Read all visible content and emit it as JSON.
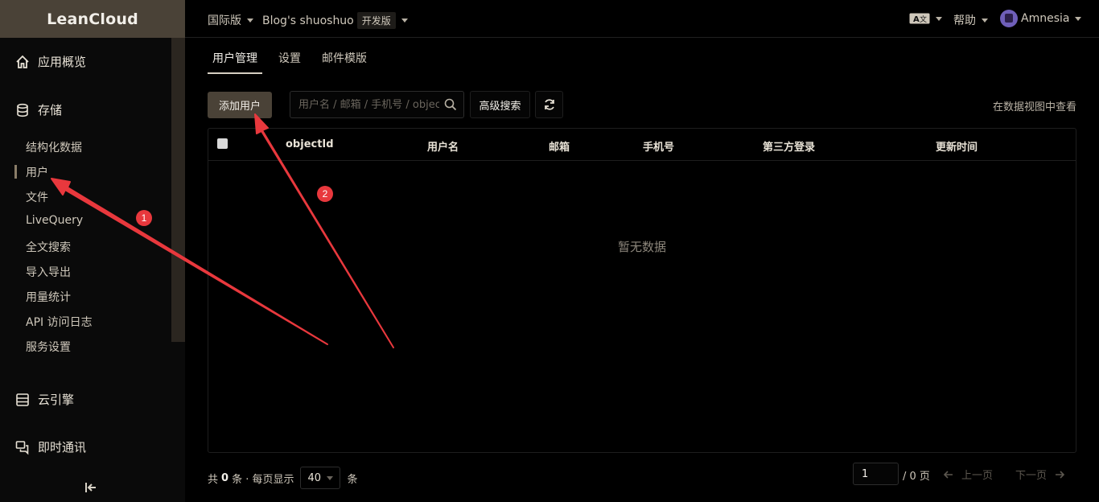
{
  "app": {
    "brand": "LeanCloud"
  },
  "header": {
    "region": "国际版",
    "app_name": "Blog's shuoshuo",
    "edition": "开发版",
    "help": "帮助",
    "username": "Amnesia",
    "lang_icon": "translate-icon"
  },
  "sidebar": {
    "overview": "应用概览",
    "storage": "存储",
    "storage_items": [
      "结构化数据",
      "用户",
      "文件",
      "LiveQuery",
      "全文搜索",
      "导入导出",
      "用量统计",
      "API 访问日志",
      "服务设置"
    ],
    "active_item": "用户",
    "cloud_engine": "云引擎",
    "messaging": "即时通讯"
  },
  "tabs": [
    "用户管理",
    "设置",
    "邮件模版"
  ],
  "toolbar": {
    "add_user": "添加用户",
    "search_placeholder": "用户名 / 邮箱 / 手机号 / objectId",
    "advanced_search": "高级搜索",
    "view_in_data": "在数据视图中查看"
  },
  "table": {
    "columns": [
      "objectId",
      "用户名",
      "邮箱",
      "手机号",
      "第三方登录",
      "更新时间"
    ],
    "empty_text": "暂无数据"
  },
  "footer": {
    "total_prefix": "共",
    "total_count": "0",
    "total_unit": "条 · 每页显示",
    "page_size": "40",
    "page_size_unit": "条",
    "current_page": "1",
    "total_pages": "/ 0 页",
    "prev": "上一页",
    "next": "下一页"
  },
  "annotations": [
    "1",
    "2"
  ],
  "colors": {
    "accent": "#4a4237",
    "annotation": "#e8383d"
  }
}
